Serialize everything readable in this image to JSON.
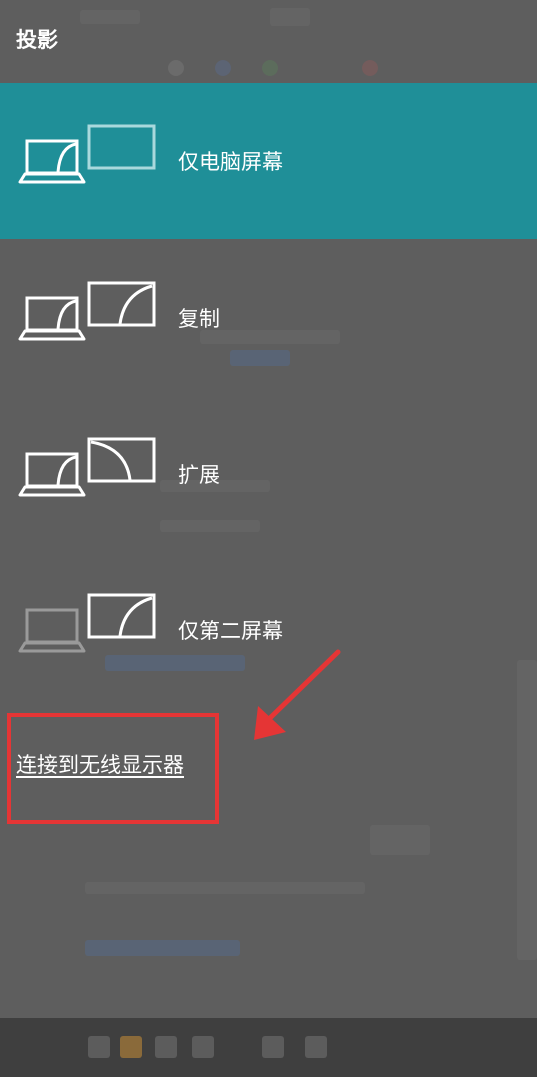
{
  "panel": {
    "title": "投影"
  },
  "modes": [
    {
      "label": "仅电脑屏幕",
      "icon": "pc-screen-only-icon",
      "selected": true
    },
    {
      "label": "复制",
      "icon": "duplicate-icon",
      "selected": false
    },
    {
      "label": "扩展",
      "icon": "extend-icon",
      "selected": false
    },
    {
      "label": "仅第二屏幕",
      "icon": "second-screen-only-icon",
      "selected": false
    }
  ],
  "wireless": {
    "link_label": "连接到无线显示器"
  },
  "colors": {
    "background": "#5e5e5e",
    "selected": "#1f8f98",
    "annotation": "#e53535"
  }
}
